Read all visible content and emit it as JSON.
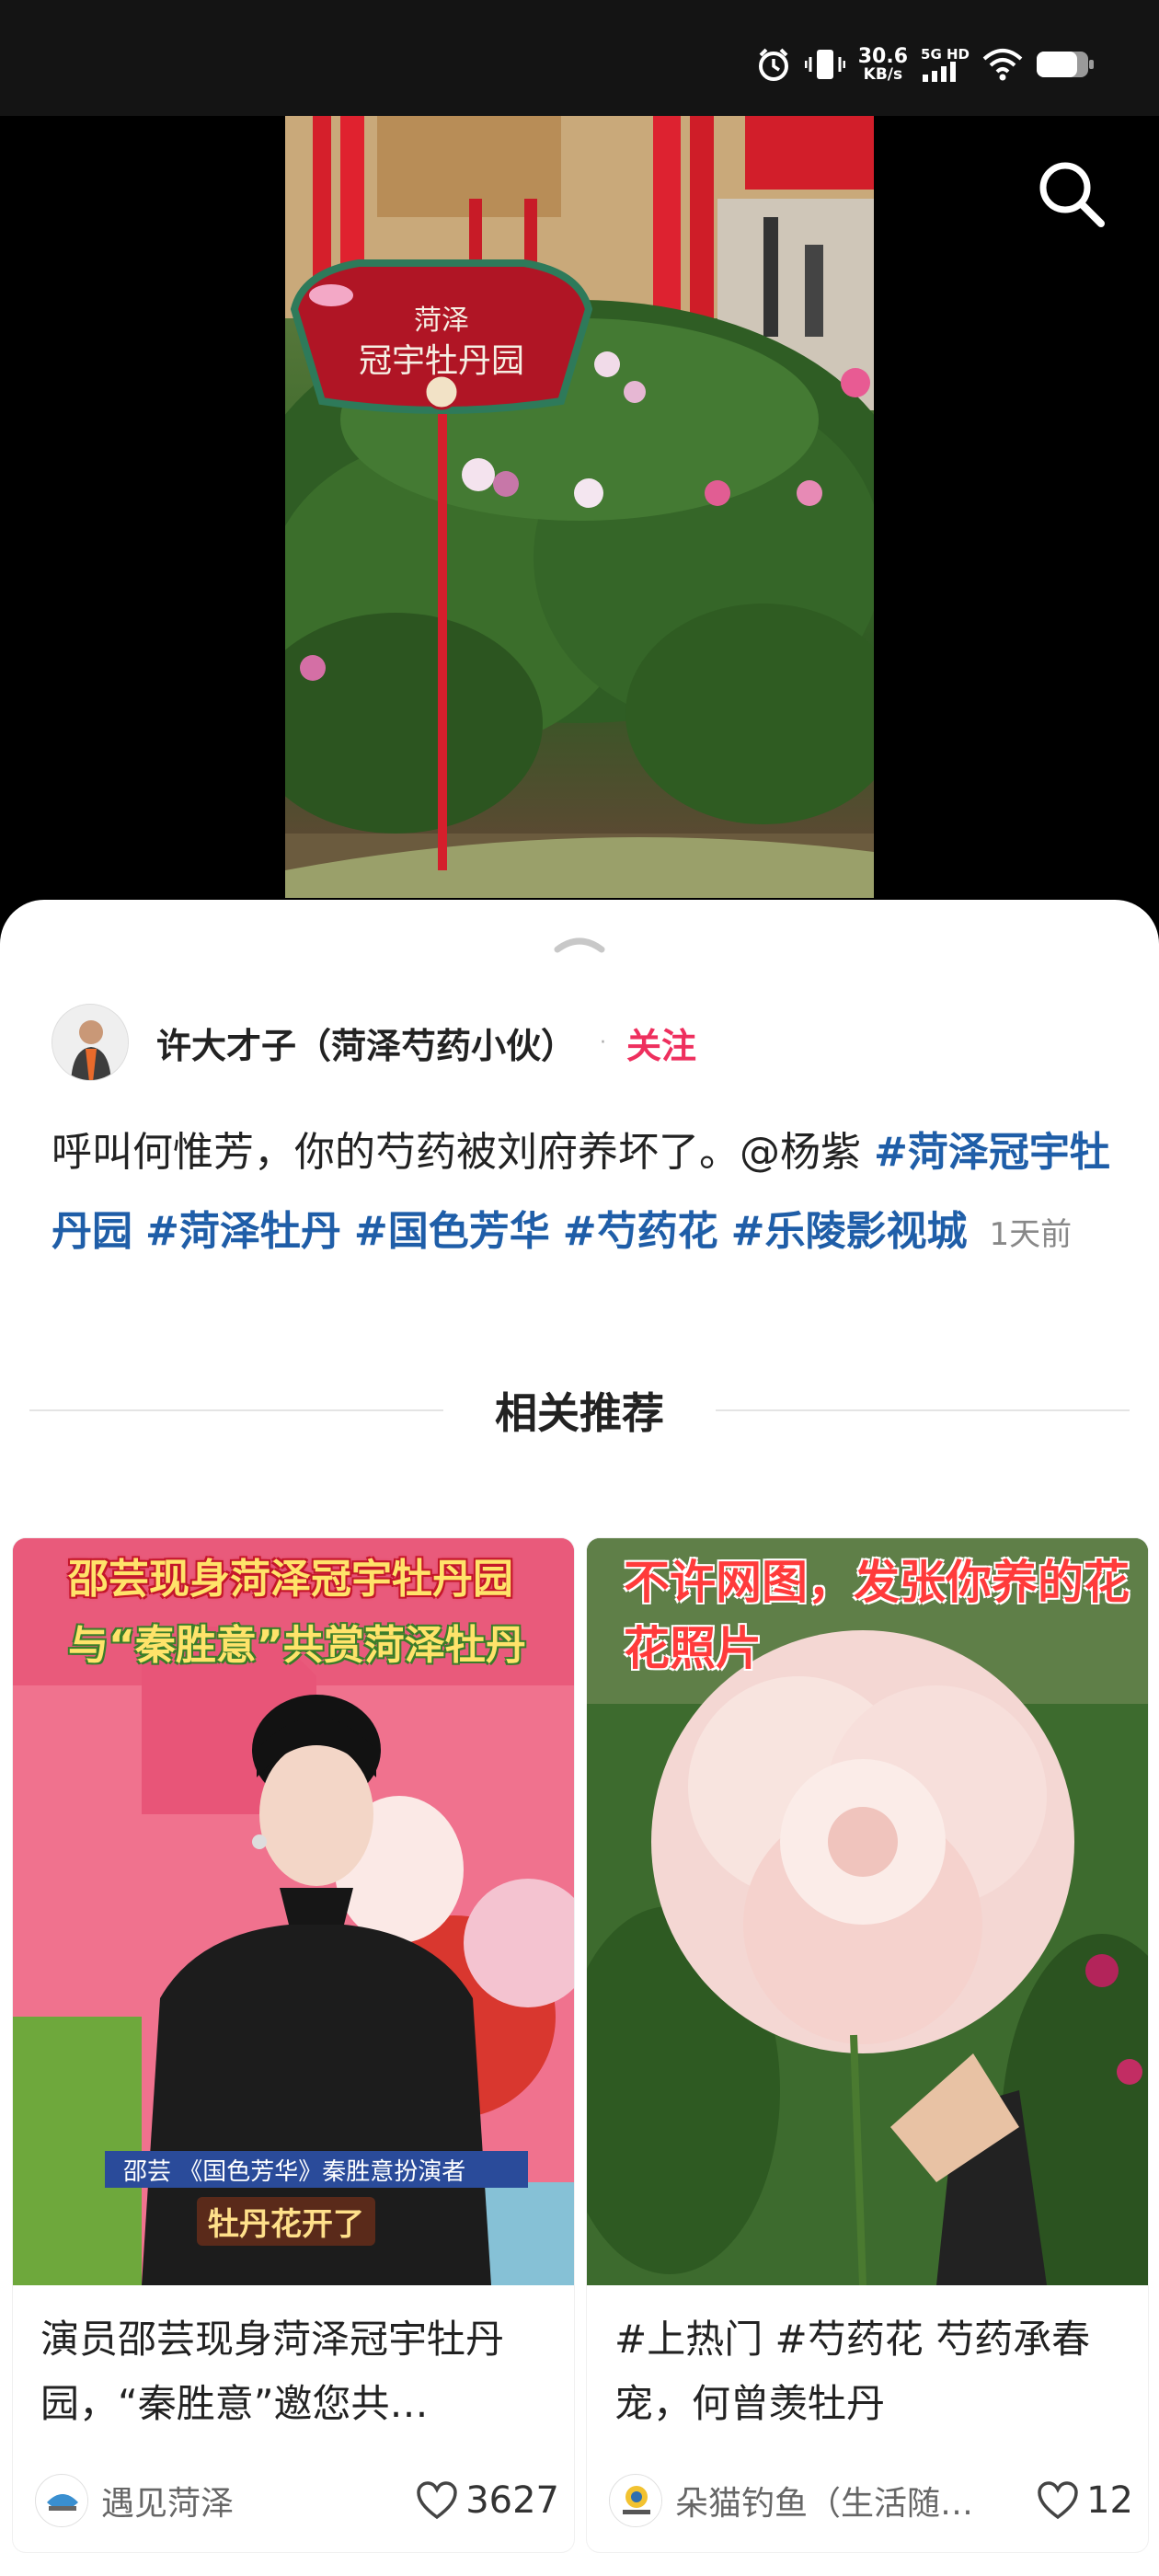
{
  "status_bar": {
    "speed_value": "30.6",
    "speed_unit": "KB/s",
    "network_type": "5G HD"
  },
  "video": {
    "sign_line1": "菏泽",
    "sign_line2": "冠宇牡丹园"
  },
  "author": {
    "name": "许大才子（菏泽芍药小伙）",
    "separator": "·",
    "follow_label": "关注"
  },
  "post": {
    "text": "呼叫何惟芳，你的芍药被刘府养坏了。@杨紫 ",
    "tags": [
      "#菏泽冠宇牡丹园",
      "#菏泽牡丹",
      "#国色芳华",
      "#芍药花",
      "#乐陵影视城"
    ],
    "time": "1天前"
  },
  "recommend": {
    "section_title": "相关推荐",
    "cards": [
      {
        "thumb_line1": "邵芸现身菏泽冠宇牡丹园",
        "thumb_line2": "与“秦胜意”共赏菏泽牡丹",
        "thumb_caption": "邵芸 《国色芳华》秦胜意扮演者",
        "thumb_caption2": "牡丹花开了",
        "title": "演员邵芸现身菏泽冠宇牡丹园，“秦胜意”邀您共…",
        "author": "遇见菏泽",
        "likes": "3627"
      },
      {
        "thumb_line1": "不许网图，发张你养的花花照片",
        "title": "#上热门 #芍药花 芍药承春宠，何曾羡牡丹",
        "author": "朵猫钓鱼（生活随…",
        "likes": "12"
      }
    ]
  },
  "colors": {
    "accent_pink": "#ee2f5e",
    "tag_blue": "#1f5ea8"
  }
}
